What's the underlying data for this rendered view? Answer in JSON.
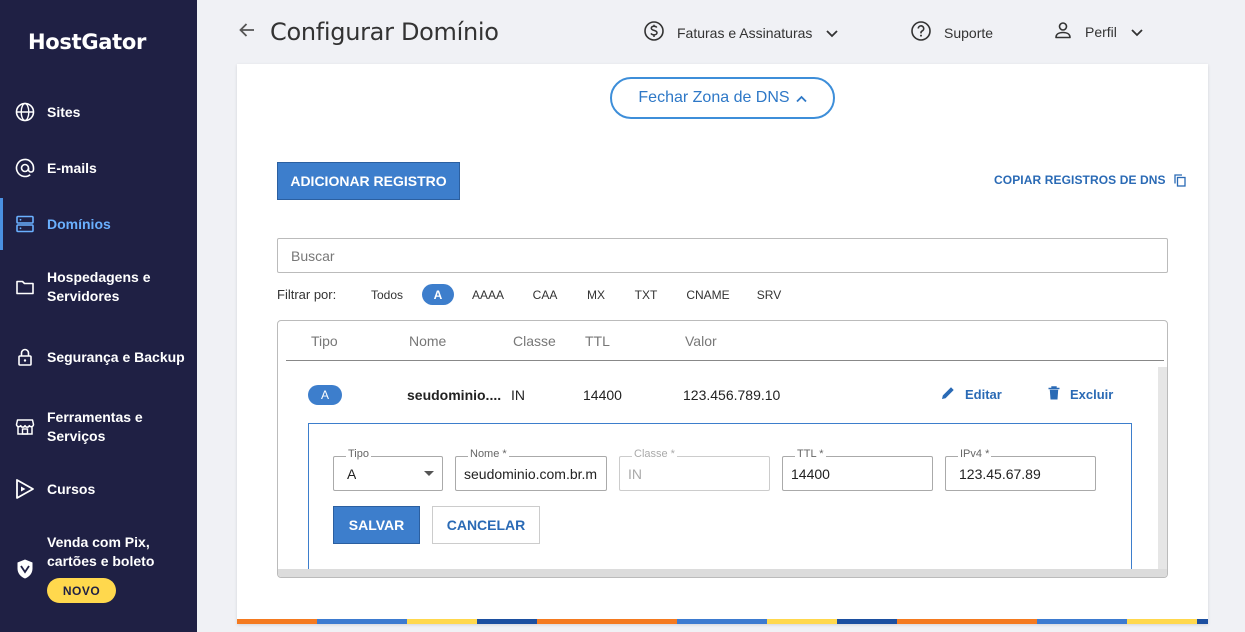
{
  "sidebar": {
    "logo": "HostGator",
    "items": [
      {
        "label": "Sites",
        "icon": "globe-icon"
      },
      {
        "label": "E-mails",
        "icon": "at-icon"
      },
      {
        "label": "Domínios",
        "icon": "server-icon"
      },
      {
        "label": "Hospedagens e Servidores",
        "icon": "folder-icon"
      },
      {
        "label": "Segurança e Backup",
        "icon": "lock-icon"
      },
      {
        "label": "Ferramentas e Serviços",
        "icon": "store-icon"
      },
      {
        "label": "Cursos",
        "icon": "play-icon"
      },
      {
        "label": "Venda com Pix, cartões e boleto",
        "icon": "shield-icon"
      }
    ],
    "badge": "NOVO",
    "active_color": "#6ab0ff"
  },
  "header": {
    "title": "Configurar Domínio",
    "billing": "Faturas e Assinaturas",
    "support": "Suporte",
    "profile": "Perfil"
  },
  "dns": {
    "close_zone": "Fechar Zona de DNS",
    "add_record": "ADICIONAR REGISTRO",
    "copy_records": "COPIAR REGISTROS DE DNS",
    "search_placeholder": "Buscar",
    "filter_label": "Filtrar por:",
    "filters": [
      "Todos",
      "A",
      "AAAA",
      "CAA",
      "MX",
      "TXT",
      "CNAME",
      "SRV"
    ],
    "active_filter": "A",
    "columns": [
      "Tipo",
      "Nome",
      "Classe",
      "TTL",
      "Valor"
    ],
    "record": {
      "type": "A",
      "name": "seudominio....",
      "class": "IN",
      "ttl": "14400",
      "value": "123.456.789.10",
      "edit": "Editar",
      "delete": "Excluir"
    },
    "form": {
      "type_label": "Tipo",
      "type_value": "A",
      "name_label": "Nome *",
      "name_value": "seudominio.com.br.m",
      "class_label": "Classe *",
      "class_value": "IN",
      "ttl_label": "TTL *",
      "ttl_value": "14400",
      "ipv4_label": "IPv4 *",
      "ipv4_value": "123.45.67.89",
      "save": "SALVAR",
      "cancel": "CANCELAR"
    }
  },
  "colors": {
    "sidebar_bg": "#1f2044",
    "primary": "#3d7ecc",
    "badge_yellow": "#ffd84d"
  }
}
